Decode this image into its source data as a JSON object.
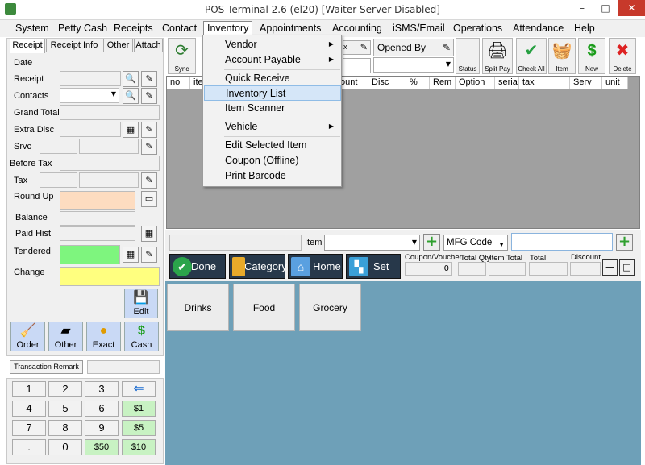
{
  "window": {
    "title": "POS Terminal 2.6 (el20) [Waiter Server Disabled]",
    "minimize": "–",
    "maximize": "□",
    "close": "✕"
  },
  "menu": [
    "System",
    "Petty Cash",
    "Receipts",
    "Contact",
    "Inventory",
    "Appointments",
    "Accounting",
    "iSMS/Email",
    "Operations",
    "Attendance",
    "Help"
  ],
  "dropdown": {
    "vendor": "Vendor",
    "account_payable": "Account Payable",
    "quick_receive": "Quick Receive",
    "inventory_list": "Inventory List",
    "item_scanner": "Item Scanner",
    "vehicle": "Vehicle",
    "edit_selected_item": "Edit Selected Item",
    "coupon_offline": "Coupon (Offline)",
    "print_barcode": "Print Barcode"
  },
  "left": {
    "tabs": [
      "Receipt",
      "Receipt Info",
      "Other",
      "Attach"
    ],
    "labels": {
      "date": "Date",
      "receipt": "Receipt",
      "contacts": "Contacts",
      "grand_total": "Grand Total",
      "extra_disc": "Extra Disc",
      "srvc": "Srvc",
      "before_tax": "Before Tax",
      "tax": "Tax",
      "round_up": "Round Up",
      "balance": "Balance",
      "paid_hist": "Paid Hist",
      "tendered": "Tendered",
      "change": "Change"
    },
    "edit": "Edit",
    "tiles": {
      "order": "Order",
      "other": "Other",
      "exact": "Exact",
      "cash": "Cash"
    },
    "transaction_remark": "Transaction Remark",
    "keys": [
      "1",
      "2",
      "3",
      "4",
      "5",
      "6",
      "7",
      "8",
      "9",
      ".",
      "0"
    ],
    "money": {
      "m1": "$1",
      "m5": "$5",
      "m50": "$50",
      "m10": "$10"
    },
    "back": "⇐"
  },
  "toolbar": {
    "sync": "Sync",
    "opened_by": "Opened By",
    "status": "Status",
    "split_pay": "Split Pay",
    "check_all": "Check All",
    "item": "Item",
    "new": "New",
    "delete": "Delete"
  },
  "grid": {
    "columns": [
      "no",
      "ite",
      "ount",
      "Disc",
      "%",
      "Rem",
      "Option",
      "seria",
      "tax",
      "Serv",
      "unit"
    ]
  },
  "item_bar": {
    "item_label": "Item",
    "mfg_code": "MFG Code"
  },
  "actions": {
    "done": "Done",
    "category": "Category",
    "home": "Home",
    "set": "Set"
  },
  "totals": {
    "coupon_voucher": "Coupon/Voucher",
    "coupon_value": "0",
    "total_qty": "Total Qty",
    "item_total": "Item Total",
    "total": "Total",
    "discount": "Discount"
  },
  "categories": [
    "Drinks",
    "Food",
    "Grocery"
  ],
  "colors": {
    "panel_bg": "#f0f0f0",
    "grid_bg": "#a0a0a0",
    "category_bg": "#6ea0b8",
    "tendered_bg": "#7ef57e",
    "change_bg": "#ffff7f",
    "round_up_bg": "#fddcc0",
    "action_bg": "#27384a"
  }
}
